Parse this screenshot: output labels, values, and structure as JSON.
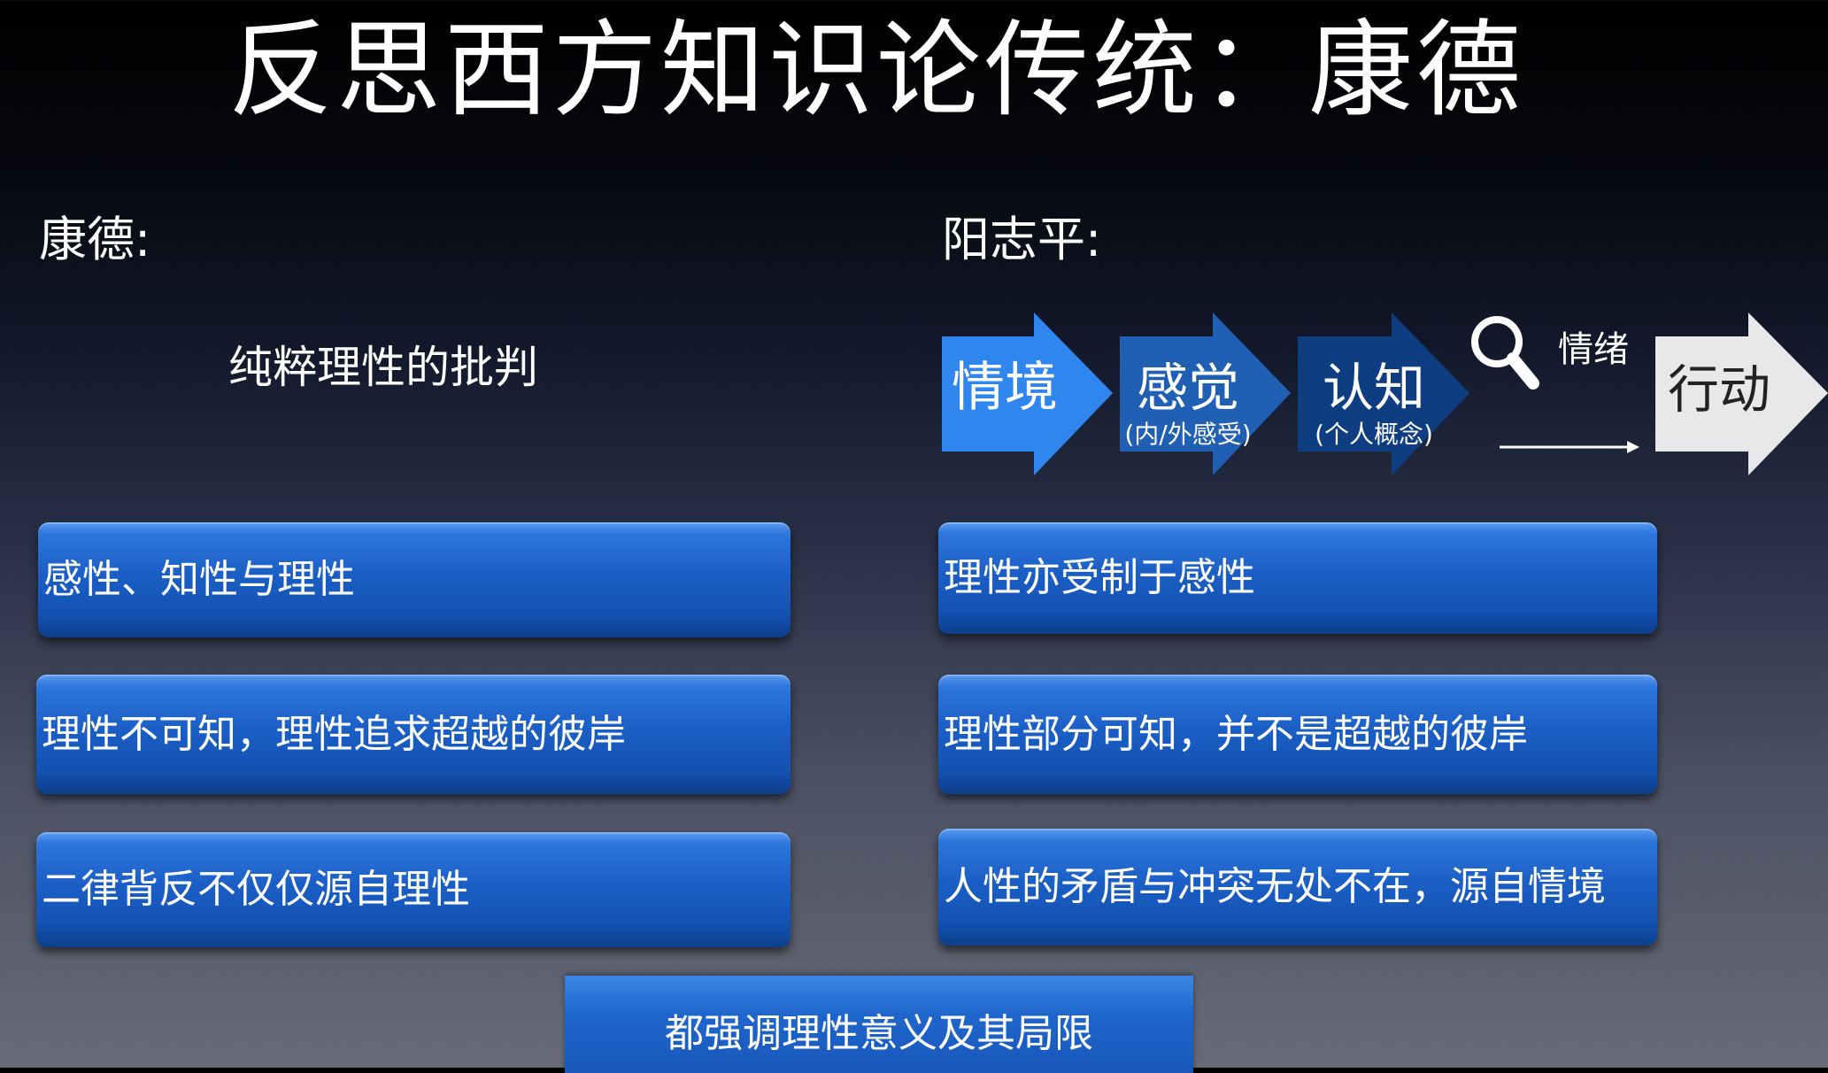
{
  "title": "反思西方知识论传统：康德",
  "kant": {
    "heading": "康德:",
    "book": "纯粹理性的批判",
    "points": [
      "感性、知性与理性",
      "理性不可知，理性追求超越的彼岸",
      "二律背反不仅仅源自理性"
    ]
  },
  "yang": {
    "heading": "阳志平:",
    "flow": {
      "step1": "情境",
      "step2": "感觉",
      "step2_note": "(内/外感受)",
      "step3": "认知",
      "step3_note": "(个人概念)",
      "emotion": "情绪",
      "step4": "行动",
      "icon": "magnifier-icon"
    },
    "points": [
      "理性亦受制于感性",
      "理性部分可知，并不是超越的彼岸",
      "人性的矛盾与冲突无处不在，源自情境"
    ]
  },
  "conclusion": "都强调理性意义及其局限",
  "colors": {
    "arrow1": "#2f86ee",
    "arrow2": "#1f5fb4",
    "arrow3": "#0f3d82",
    "arrow4": "#e8e8ea",
    "box": "#1b5fc6"
  }
}
